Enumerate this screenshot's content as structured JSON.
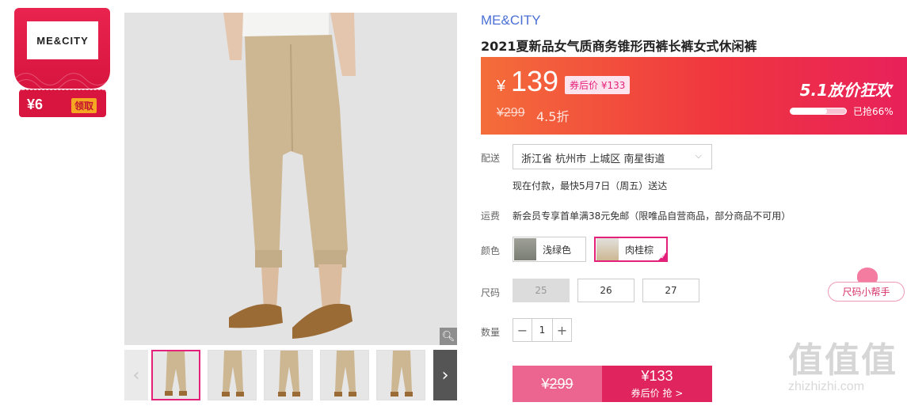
{
  "coupon": {
    "logo": "ME&CITY",
    "amount": "¥6",
    "claim_label": "领取"
  },
  "gallery": {
    "zoom_icon": "magnifier-icon",
    "prev_icon": "chevron-left-icon",
    "next_icon": "chevron-right-icon",
    "thumbnail_count": 6
  },
  "product": {
    "brand": "ME&CITY",
    "title": "2021夏新品女气质商务锥形西裤长裤女式休闲裤"
  },
  "price": {
    "symbol": "¥",
    "current": "139",
    "coupon_price": "券后价 ¥133",
    "original": "¥299",
    "discount": "4.5折",
    "promo_title": "5.1放价狂欢",
    "sold_text": "已抢66%",
    "sold_fraction": 0.66
  },
  "delivery": {
    "label": "配送",
    "address": "浙江省 杭州市 上城区 南星街道",
    "note": "现在付款，最快5月7日（周五）送达"
  },
  "shipping": {
    "label": "运费",
    "text": "新会员专享首单满38元免邮（限唯品自营商品，部分商品不可用）"
  },
  "color": {
    "label": "颜色",
    "options": [
      {
        "name": "浅绿色",
        "selected": false
      },
      {
        "name": "肉桂棕",
        "selected": true
      }
    ]
  },
  "size": {
    "label": "尺码",
    "options": [
      {
        "value": "25",
        "disabled": true
      },
      {
        "value": "26",
        "disabled": false
      },
      {
        "value": "27",
        "disabled": false
      }
    ],
    "helper": "尺码小帮手"
  },
  "quantity": {
    "label": "数量",
    "value": "1",
    "minus": "−",
    "plus": "+"
  },
  "buy": {
    "original_price": "¥299",
    "coupon_price": "¥133",
    "coupon_action": "券后价 抢 >"
  },
  "watermark": {
    "logo": "值值值",
    "url": "zhizhizhi.com"
  },
  "colors": {
    "accent": "#e4217a",
    "brand_link": "#4b6fd6",
    "banner_start": "#f46d3a",
    "banner_end": "#e8215a"
  }
}
